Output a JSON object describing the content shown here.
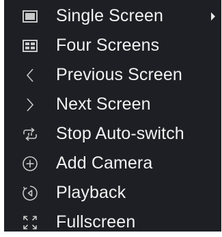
{
  "menu": {
    "items": [
      {
        "label": "Single Screen",
        "icon": "single-screen-icon",
        "has_submenu": true
      },
      {
        "label": "Four Screens",
        "icon": "four-screens-icon",
        "has_submenu": false
      },
      {
        "label": "Previous Screen",
        "icon": "chevron-left-icon",
        "has_submenu": false
      },
      {
        "label": "Next Screen",
        "icon": "chevron-right-icon",
        "has_submenu": false
      },
      {
        "label": "Stop Auto-switch",
        "icon": "auto-switch-icon",
        "has_submenu": false
      },
      {
        "label": "Add Camera",
        "icon": "add-circle-icon",
        "has_submenu": false
      },
      {
        "label": "Playback",
        "icon": "playback-icon",
        "has_submenu": false
      },
      {
        "label": "Fullscreen",
        "icon": "fullscreen-icon",
        "has_submenu": false
      }
    ]
  },
  "colors": {
    "background": "#1d1f24",
    "text": "#f2f2f2",
    "icon": "#c8c8c8"
  }
}
